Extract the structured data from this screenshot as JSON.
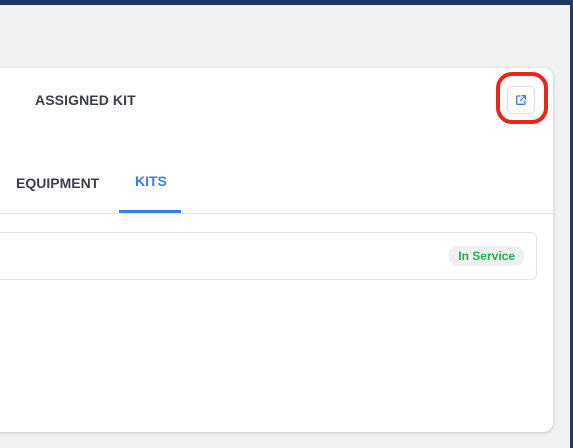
{
  "card": {
    "title": "ASSIGNED KIT",
    "open_button_icon": "external-link-icon"
  },
  "tabs": [
    {
      "label": "EQUIPMENT",
      "active": false
    },
    {
      "label": "KITS",
      "active": true
    }
  ],
  "kits": [
    {
      "status": "In Service",
      "status_color": "#26b04a"
    }
  ],
  "colors": {
    "accent": "#3b7be8",
    "highlight_ring": "#e8271a",
    "top_bar": "#1f3a5c"
  }
}
